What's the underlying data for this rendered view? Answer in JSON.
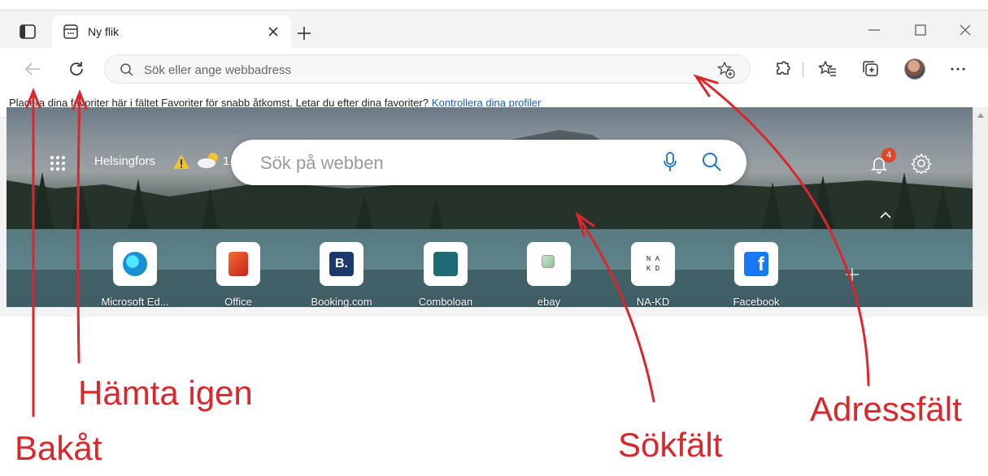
{
  "tab": {
    "title": "Ny flik"
  },
  "address": {
    "placeholder": "Sök eller ange webbadress"
  },
  "favorites_bar": {
    "message": "Placera dina favoriter här i fältet Favoriter för snabb åtkomst. Letar du efter dina favoriter?",
    "link": "Kontrollera dina profiler"
  },
  "ntp": {
    "city": "Helsingfors",
    "temperature": "1",
    "search_placeholder": "Sök på webben",
    "notification_count": "4",
    "tiles": [
      {
        "label": "Microsoft Ed...",
        "icon": "edge-icon"
      },
      {
        "label": "Office",
        "icon": "office-icon"
      },
      {
        "label": "Booking.com",
        "icon": "booking-icon"
      },
      {
        "label": "Comboloan",
        "icon": "comboloan-icon"
      },
      {
        "label": "ebay",
        "icon": "broken-image-icon"
      },
      {
        "label": "NA-KD",
        "icon": "nakd-icon"
      },
      {
        "label": "Facebook",
        "icon": "facebook-icon"
      }
    ]
  },
  "annotations": {
    "back": "Bakåt",
    "reload": "Hämta igen",
    "search_field": "Sökfält",
    "address_field": "Adressfält"
  },
  "colors": {
    "annotation": "#d8272d",
    "link": "#1a5fb4",
    "badge": "#e0452a"
  }
}
